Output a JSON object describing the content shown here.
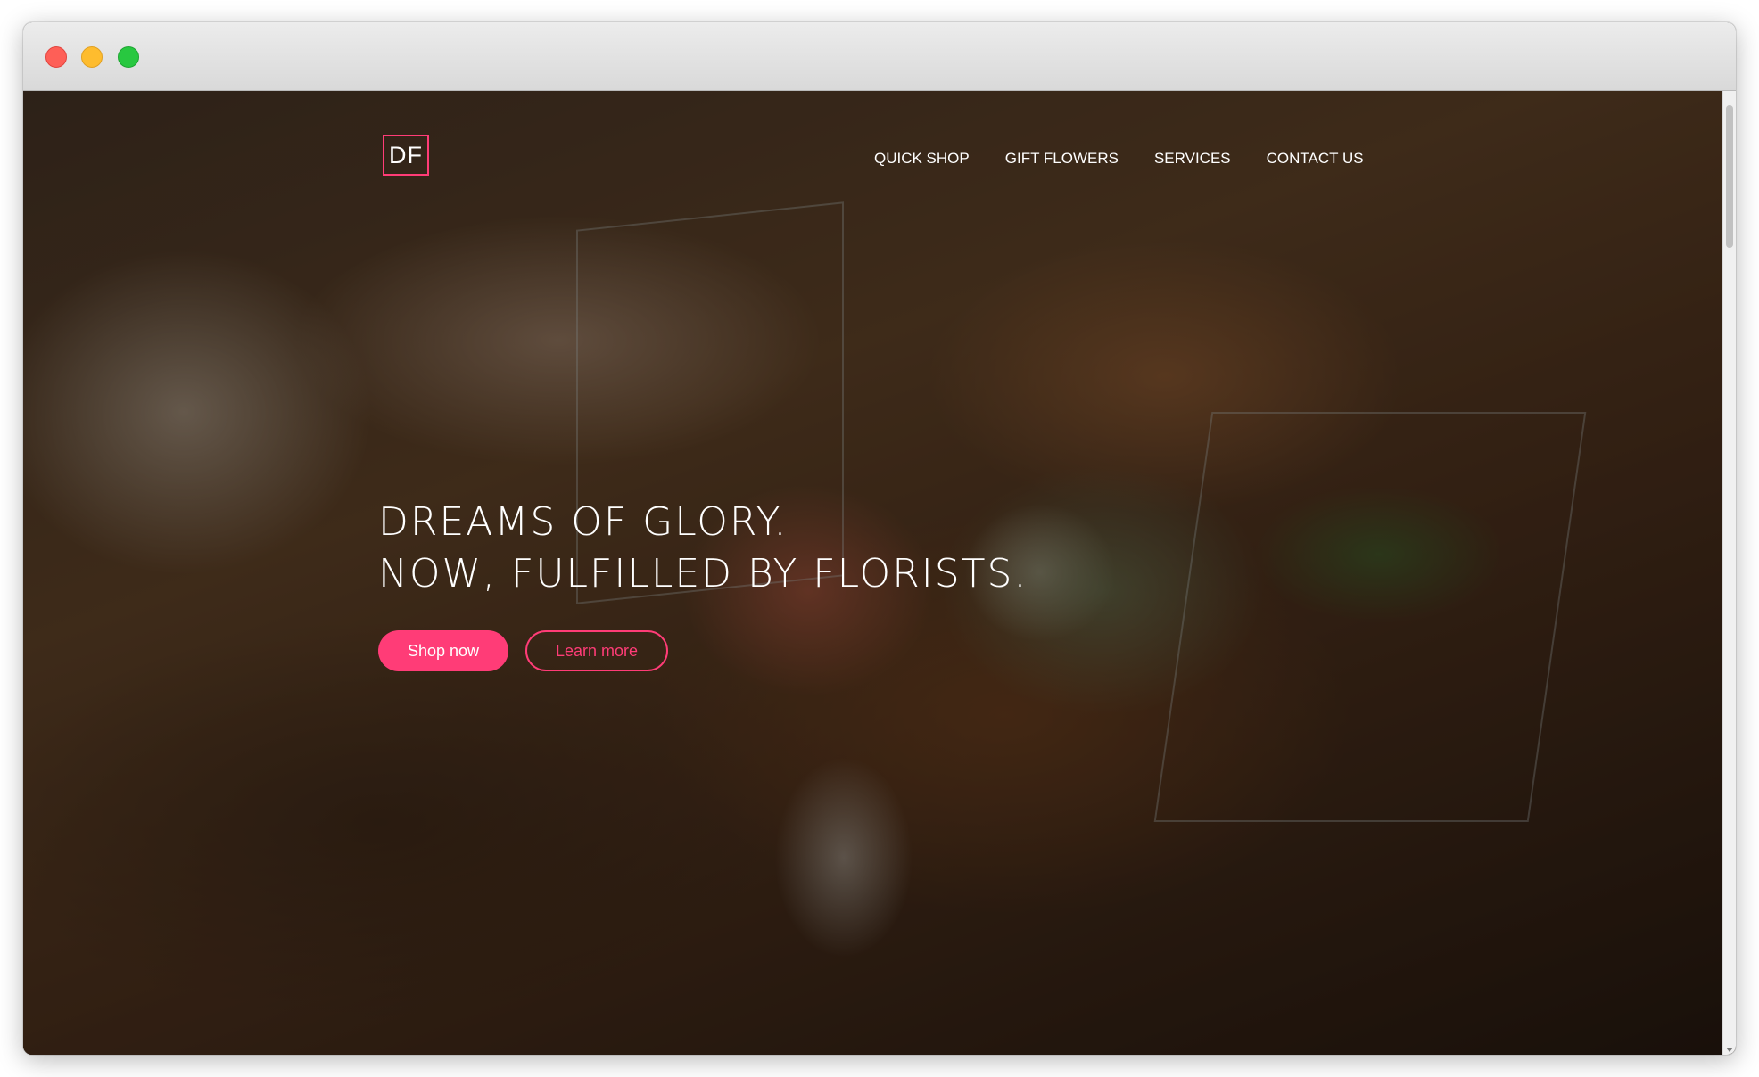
{
  "window": {
    "traffic_lights": {
      "close_color": "#fe5f57",
      "minimize_color": "#febc2e",
      "maximize_color": "#28c840"
    }
  },
  "site": {
    "logo_text": "DF",
    "accent_color": "#ff3c77",
    "nav": [
      {
        "label": "QUICK SHOP"
      },
      {
        "label": "GIFT FLOWERS"
      },
      {
        "label": "SERVICES"
      },
      {
        "label": "CONTACT US"
      }
    ],
    "hero": {
      "headline_line1": "DREAMS OF GLORY.",
      "headline_line2": "NOW, FULFILLED BY FLORISTS.",
      "primary_button": "Shop now",
      "secondary_button": "Learn more"
    }
  }
}
